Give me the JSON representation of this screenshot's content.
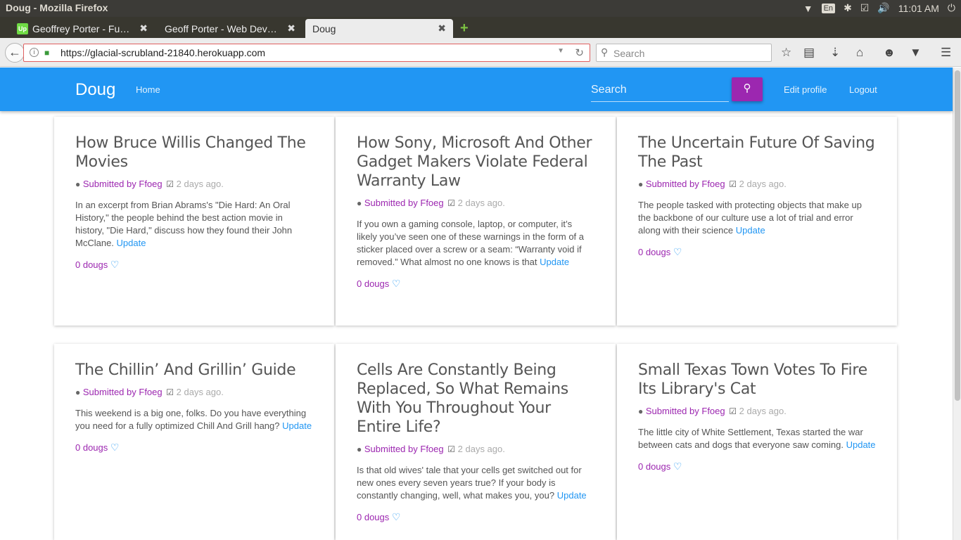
{
  "os": {
    "window_title": "Doug - Mozilla Firefox",
    "keyboard": "En",
    "clock": "11:01 AM"
  },
  "browser": {
    "tabs": [
      {
        "label": "Geoffrey Porter - Fu…",
        "favicon": "Up"
      },
      {
        "label": "Geoff Porter - Web Dev…"
      },
      {
        "label": "Doug"
      }
    ],
    "url": "https://glacial-scrubland-21840.herokuapp.com",
    "search_placeholder": "Search"
  },
  "site": {
    "brand": "Doug",
    "nav_home": "Home",
    "search_placeholder": "Search",
    "edit_profile": "Edit profile",
    "logout": "Logout",
    "accent": "#2196f3",
    "purple": "#9c27b0"
  },
  "posts": [
    {
      "title": "How Bruce Willis Changed The Movies",
      "submitted": "Submitted by",
      "author": "Ffoeg",
      "time": "2 days ago.",
      "desc": "In an excerpt from Brian Abrams's \"Die Hard: An Oral History,\" the people behind the best action movie in history, \"Die Hard,\" discuss how they found their John McClane.",
      "update": "Update",
      "dougs": "0 dougs"
    },
    {
      "title": "How Sony, Microsoft And Other Gadget Makers Violate Federal Warranty Law",
      "submitted": "Submitted by",
      "author": "Ffoeg",
      "time": "2 days ago.",
      "desc": "If you own a gaming console, laptop, or computer, it’s likely you’ve seen one of these warnings in the form of a sticker placed over a screw or a seam: “Warranty void if removed.” What almost no one knows is that",
      "update": "Update",
      "dougs": "0 dougs"
    },
    {
      "title": "The Uncertain Future Of Saving The Past",
      "submitted": "Submitted by",
      "author": "Ffoeg",
      "time": "2 days ago.",
      "desc": "The people tasked with protecting objects that make up the backbone of our culture use a lot of trial and error along with their science",
      "update": "Update",
      "dougs": "0 dougs"
    },
    {
      "title": "The Chillin’ And Grillin’ Guide",
      "submitted": "Submitted by",
      "author": "Ffoeg",
      "time": "2 days ago.",
      "desc": "This weekend is a big one, folks. Do you have everything you need for a fully optimized Chill And Grill hang?",
      "update": "Update",
      "dougs": "0 dougs"
    },
    {
      "title": "Cells Are Constantly Being Replaced, So What Remains With You Throughout Your Entire Life?",
      "submitted": "Submitted by",
      "author": "Ffoeg",
      "time": "2 days ago.",
      "desc": "Is that old wives' tale that your cells get switched out for new ones every seven years true? If your body is constantly changing, well, what makes you, you?",
      "update": "Update",
      "dougs": "0 dougs"
    },
    {
      "title": "Small Texas Town Votes To Fire Its Library's Cat",
      "submitted": "Submitted by",
      "author": "Ffoeg",
      "time": "2 days ago.",
      "desc": "The little city of White Settlement, Texas started the war between cats and dogs that everyone saw coming.",
      "update": "Update",
      "dougs": "0 dougs"
    }
  ]
}
